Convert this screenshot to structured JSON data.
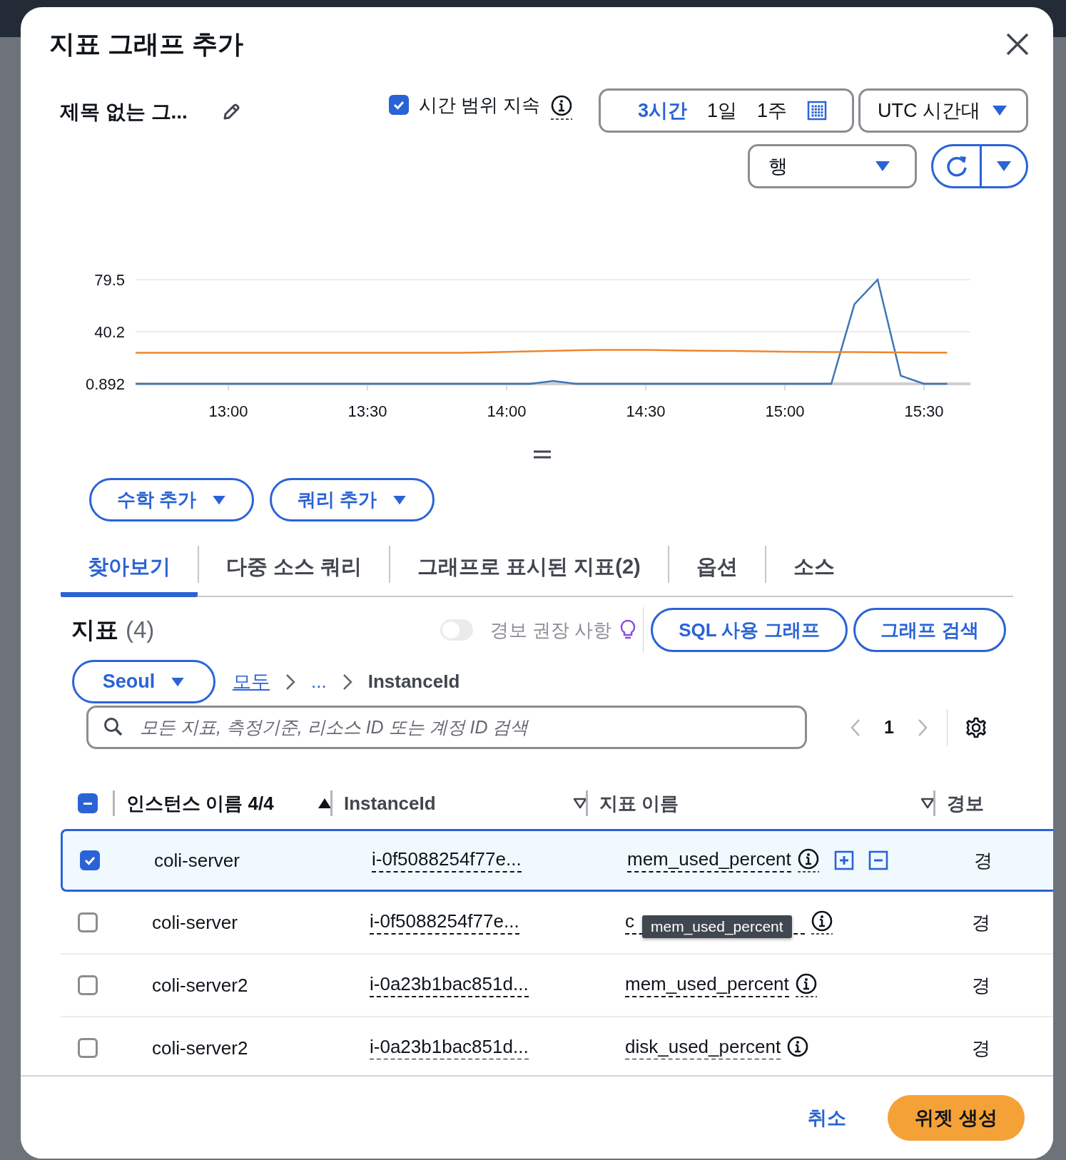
{
  "dialog": {
    "title": "지표 그래프 추가"
  },
  "graph_title": "제목 없는 그...",
  "persist_time_range": {
    "label": "시간 범위 지속",
    "checked": true
  },
  "time_ranges": [
    {
      "label": "3시간",
      "selected": true
    },
    {
      "label": "1일",
      "selected": false
    },
    {
      "label": "1주",
      "selected": false
    }
  ],
  "timezone": {
    "value": "UTC 시간대"
  },
  "graph_type": {
    "value": "행"
  },
  "chart_data": {
    "type": "line",
    "x": [
      760,
      765,
      770,
      775,
      780,
      785,
      790,
      795,
      800,
      805,
      810,
      815,
      820,
      825,
      830,
      835,
      840,
      845,
      850,
      855,
      860,
      865,
      870,
      875,
      880,
      885,
      890,
      895,
      900,
      905,
      910,
      915,
      920,
      925,
      930,
      935
    ],
    "xlim": [
      760,
      940
    ],
    "ylim": [
      0.892,
      79.5
    ],
    "yticks": [
      0.892,
      40.2,
      79.5
    ],
    "xticks": [
      {
        "value": 780,
        "label": "13:00"
      },
      {
        "value": 810,
        "label": "13:30"
      },
      {
        "value": 840,
        "label": "14:00"
      },
      {
        "value": 870,
        "label": "14:30"
      },
      {
        "value": 900,
        "label": "15:00"
      },
      {
        "value": 930,
        "label": "15:30"
      }
    ],
    "series": [
      {
        "color": "#3f76b5",
        "values": [
          0.892,
          0.892,
          0.892,
          0.892,
          0.892,
          0.892,
          0.892,
          0.892,
          0.892,
          0.892,
          0.892,
          0.892,
          0.892,
          0.892,
          0.892,
          0.892,
          0.892,
          0.892,
          3,
          0.892,
          0.892,
          0.892,
          0.892,
          0.892,
          0.892,
          0.892,
          0.892,
          0.892,
          0.892,
          0.892,
          0.892,
          61,
          79.5,
          7,
          0.892,
          0.892
        ]
      },
      {
        "color": "#f0862c",
        "values": [
          24.3,
          24.3,
          24.3,
          24.3,
          24.3,
          24.3,
          24.3,
          24.3,
          24.3,
          24.3,
          24.3,
          24.3,
          24.3,
          24.3,
          24.3,
          24.6,
          25,
          25.4,
          25.8,
          26.2,
          26.4,
          26.5,
          26.4,
          26.2,
          26,
          25.8,
          25.6,
          25.4,
          25.2,
          25,
          24.9,
          24.8,
          24.7,
          24.6,
          24.5,
          24.5
        ]
      }
    ]
  },
  "query_buttons": [
    "수학 추가",
    "쿼리 추가"
  ],
  "tabs": [
    {
      "label": "찾아보기",
      "selected": true
    },
    {
      "label": "다중 소스 쿼리",
      "selected": false
    },
    {
      "label": "그래프로 표시된 지표(2)",
      "selected": false
    },
    {
      "label": "옵션",
      "selected": false
    },
    {
      "label": "소스",
      "selected": false
    }
  ],
  "metrics": {
    "title": "지표",
    "count": "(4)",
    "alarm_recommendations": {
      "label": "경보 권장 사항",
      "on": false
    },
    "actions": [
      "SQL 사용 그래프",
      "그래프 검색"
    ]
  },
  "region": {
    "value": "Seoul"
  },
  "breadcrumb": [
    "모두",
    "...",
    "InstanceId"
  ],
  "search": {
    "placeholder": "모든 지표, 측정기준, 리소스 ID 또는 계정 ID 검색"
  },
  "pagination": {
    "page": "1"
  },
  "table": {
    "select_all": {
      "indeterminate": true
    },
    "columns": [
      {
        "label": "인스턴스 이름 4/4",
        "sortable": true,
        "sorted": true
      },
      {
        "label": "InstanceId",
        "sortable": true,
        "sorted": false
      },
      {
        "label": "지표 이름",
        "sortable": true,
        "sorted": false
      },
      {
        "label": "경보",
        "sortable": false,
        "sorted": false
      }
    ],
    "rows": [
      {
        "selected": true,
        "instance_name": "coli-server",
        "instance_id": "i-0f5088254f77e...",
        "metric": "mem_used_percent",
        "alarm": "경"
      },
      {
        "selected": false,
        "instance_name": "coli-server",
        "instance_id": "i-0f5088254f77e...",
        "metric": "c",
        "alarm": "경",
        "tooltip": "mem_used_percent"
      },
      {
        "selected": false,
        "instance_name": "coli-server2",
        "instance_id": "i-0a23b1bac851d...",
        "metric": "mem_used_percent",
        "alarm": "경"
      },
      {
        "selected": false,
        "instance_name": "coli-server2",
        "instance_id": "i-0a23b1bac851d...",
        "metric": "disk_used_percent",
        "alarm": "경"
      }
    ]
  },
  "footer": {
    "cancel": "취소",
    "submit": "위젯 생성"
  }
}
